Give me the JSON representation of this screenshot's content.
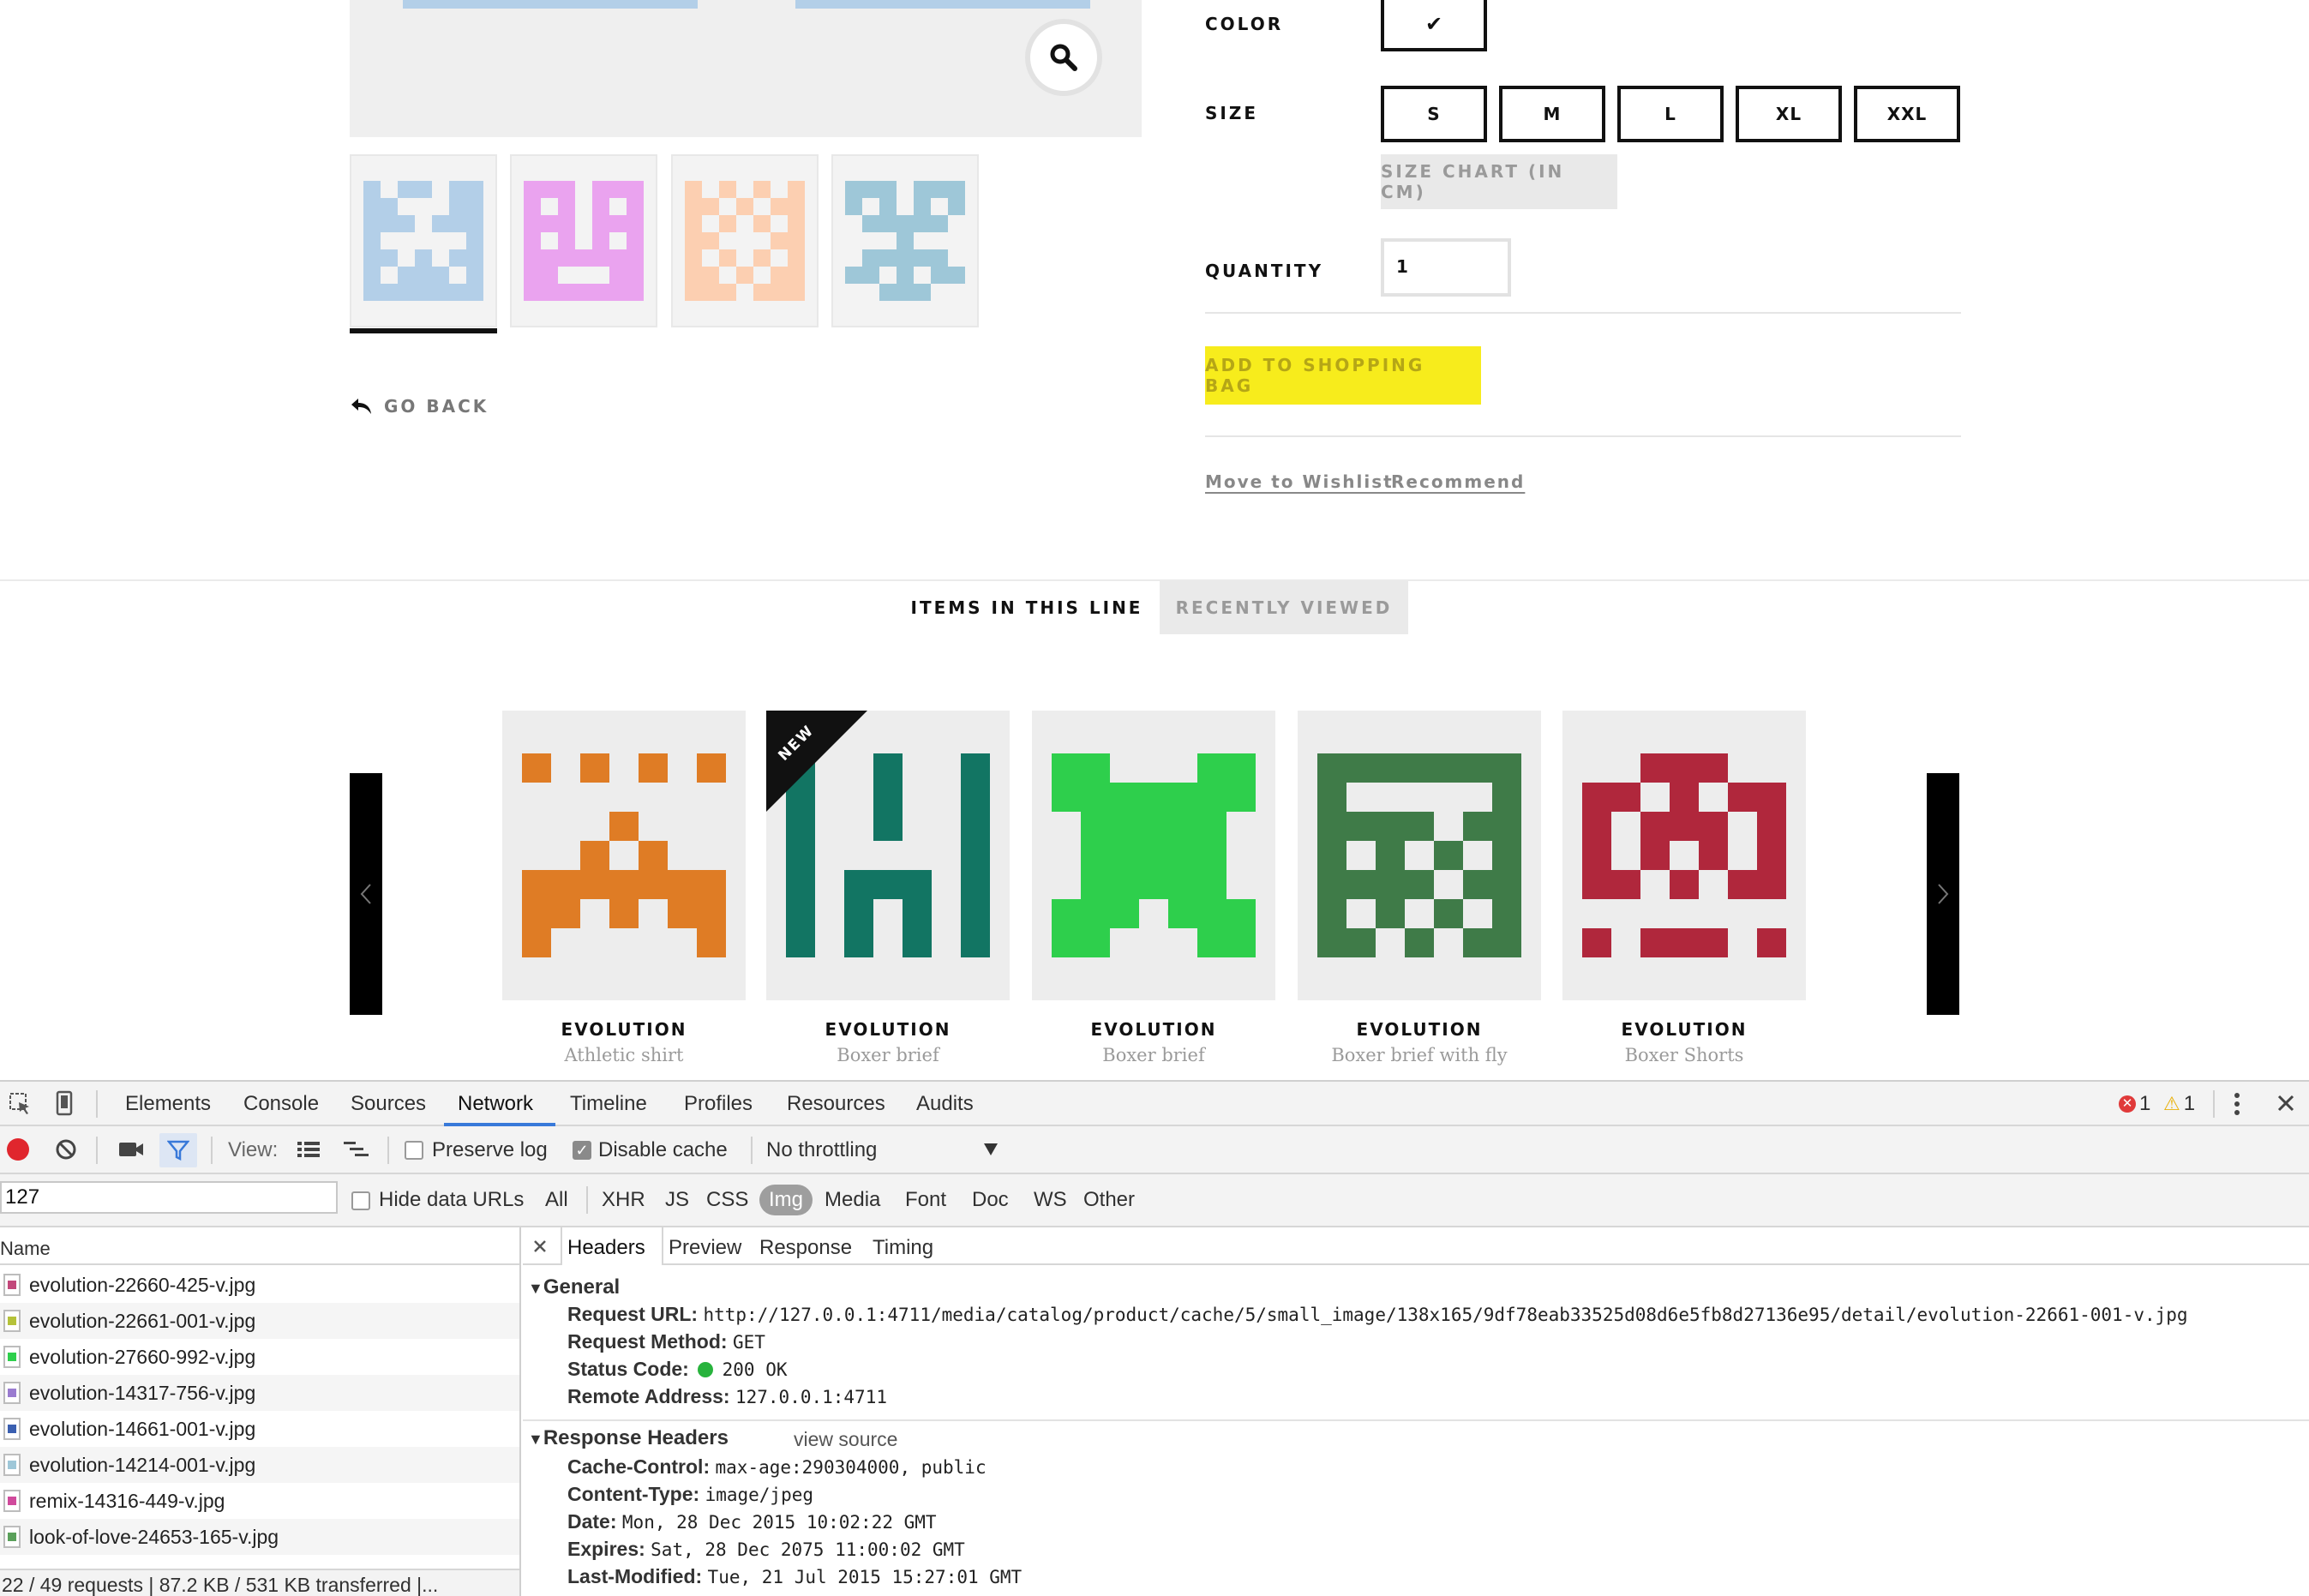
{
  "product": {
    "color_label": "COLOR",
    "color_check": "✔",
    "size_label": "SIZE",
    "sizes": [
      "S",
      "M",
      "L",
      "XL",
      "XXL"
    ],
    "size_chart": "SIZE CHART (IN CM)",
    "quantity_label": "QUANTITY",
    "quantity_value": "1",
    "add_to_bag": "ADD TO SHOPPING BAG",
    "move_to_wishlist": "Move to Wishlist",
    "recommend": "Recommend",
    "go_back": "GO BACK",
    "thumb_colors": [
      "#b3cfe8",
      "#eaa3ef",
      "#fccfb1",
      "#9ec7d8"
    ]
  },
  "line_tabs": {
    "items_in_line": "ITEMS IN THIS LINE",
    "recently_viewed": "RECENTLY VIEWED"
  },
  "carousel": {
    "items": [
      {
        "brand": "EVOLUTION",
        "name": "Athletic shirt",
        "color": "#df7c25"
      },
      {
        "brand": "EVOLUTION",
        "name": "Boxer brief",
        "color": "#127563",
        "badge": "NEW"
      },
      {
        "brand": "EVOLUTION",
        "name": "Boxer brief",
        "color": "#2ecf4c"
      },
      {
        "brand": "EVOLUTION",
        "name": "Boxer brief with fly",
        "color": "#3f7b48"
      },
      {
        "brand": "EVOLUTION",
        "name": "Boxer Shorts",
        "color": "#b0273c"
      }
    ]
  },
  "devtools": {
    "tabs": [
      "Elements",
      "Console",
      "Sources",
      "Network",
      "Timeline",
      "Profiles",
      "Resources",
      "Audits"
    ],
    "active_tab": "Network",
    "error_count": "1",
    "warning_count": "1",
    "toolbar": {
      "view_label": "View:",
      "preserve_log": "Preserve log",
      "disable_cache": "Disable cache",
      "throttling": "No throttling"
    },
    "filter": {
      "value": "127",
      "hide_data_urls": "Hide data URLs",
      "types": [
        "All",
        "XHR",
        "JS",
        "CSS",
        "Img",
        "Media",
        "Font",
        "Doc",
        "WS",
        "Other"
      ],
      "active_type": "Img"
    },
    "name_header": "Name",
    "files": [
      {
        "name": "evolution-22660-425-v.jpg",
        "color": "#c2477a"
      },
      {
        "name": "evolution-22661-001-v.jpg",
        "color": "#b5c23a"
      },
      {
        "name": "evolution-27660-992-v.jpg",
        "color": "#2ecf4c"
      },
      {
        "name": "evolution-14317-756-v.jpg",
        "color": "#9a7bd0"
      },
      {
        "name": "evolution-14661-001-v.jpg",
        "color": "#3a5fb0"
      },
      {
        "name": "evolution-14214-001-v.jpg",
        "color": "#9ec7d8"
      },
      {
        "name": "remix-14316-449-v.jpg",
        "color": "#d04a9c"
      },
      {
        "name": "look-of-love-24653-165-v.jpg",
        "color": "#5aa05a"
      }
    ],
    "status": "22 / 49 requests | 87.2 KB / 531 KB transferred |...",
    "detail_tabs": [
      "Headers",
      "Preview",
      "Response",
      "Timing"
    ],
    "general": {
      "title": "General",
      "request_url_label": "Request URL:",
      "request_url": "http://127.0.0.1:4711/media/catalog/product/cache/5/small_image/138x165/9df78eab33525d08d6e5fb8d27136e95/detail/evolution-22661-001-v.jpg",
      "request_method_label": "Request Method:",
      "request_method": "GET",
      "status_code_label": "Status Code:",
      "status_code": "200 OK",
      "remote_address_label": "Remote Address:",
      "remote_address": "127.0.0.1:4711"
    },
    "response_headers": {
      "title": "Response Headers",
      "view_source": "view source",
      "cache_control_label": "Cache-Control:",
      "cache_control": "max-age:290304000, public",
      "content_type_label": "Content-Type:",
      "content_type": "image/jpeg",
      "date_label": "Date:",
      "date": "Mon, 28 Dec 2015 10:02:22 GMT",
      "expires_label": "Expires:",
      "expires": "Sat, 28 Dec 2075 11:00:02 GMT",
      "last_modified_label": "Last-Modified:",
      "last_modified": "Tue, 21 Jul 2015 15:27:01 GMT"
    }
  }
}
